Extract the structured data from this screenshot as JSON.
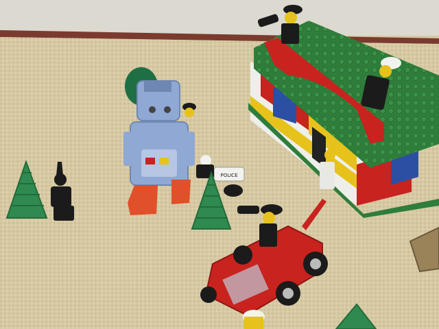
{
  "scene": {
    "police_sticker_text": "POLICE",
    "colors": {
      "carpet": "#d6c9a3",
      "wall": "#dcd9d0",
      "baseboard": "#7a3b2e",
      "lego_green": "#2f7d3a",
      "lego_red": "#c8231f",
      "lego_yellow": "#e6c21b",
      "lego_white": "#eeeeea",
      "lego_blue": "#2c4fa3",
      "robot_blue": "#8fa8d4",
      "robot_orange": "#e0502a",
      "tree_green": "#2f8a4f",
      "minifig_black": "#1b1b1b"
    }
  }
}
